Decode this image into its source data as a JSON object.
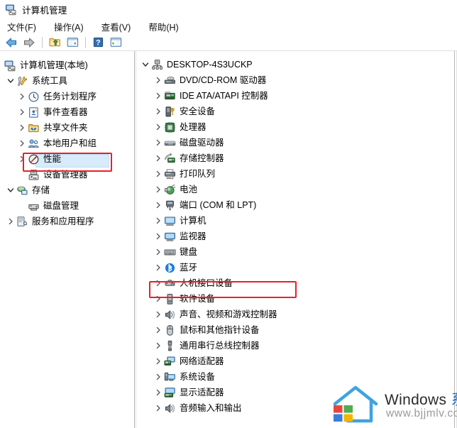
{
  "window": {
    "title": "计算机管理",
    "title_icon": "computer-management-icon"
  },
  "menubar": {
    "items": [
      {
        "label": "文件(F)",
        "name": "menu-file"
      },
      {
        "label": "操作(A)",
        "name": "menu-action"
      },
      {
        "label": "查看(V)",
        "name": "menu-view"
      },
      {
        "label": "帮助(H)",
        "name": "menu-help"
      }
    ]
  },
  "toolbar": {
    "buttons": [
      {
        "name": "back-button",
        "icon": "arrow-left-icon",
        "title": "后退"
      },
      {
        "name": "forward-button",
        "icon": "arrow-right-icon",
        "title": "前进"
      },
      {
        "name": "up-folder-button",
        "icon": "folder-up-icon",
        "title": "向上一级"
      },
      {
        "name": "show-hide-tree-button",
        "icon": "show-tree-icon",
        "title": "显示/隐藏控制台树"
      },
      {
        "name": "help-button",
        "icon": "question-mark-icon",
        "title": "帮助"
      },
      {
        "name": "show-action-pane-button",
        "icon": "action-pane-icon",
        "title": "显示/隐藏操作窗格"
      }
    ]
  },
  "left_tree": {
    "root": {
      "label": "计算机管理(本地)",
      "icon": "computer-management-icon",
      "expanded": true
    },
    "items": [
      {
        "label": "系统工具",
        "icon": "system-tools-icon",
        "indent": 1,
        "chevron": "expanded"
      },
      {
        "label": "任务计划程序",
        "icon": "task-scheduler-icon",
        "indent": 2,
        "chevron": "collapsed"
      },
      {
        "label": "事件查看器",
        "icon": "event-viewer-icon",
        "indent": 2,
        "chevron": "collapsed"
      },
      {
        "label": "共享文件夹",
        "icon": "shared-folders-icon",
        "indent": 2,
        "chevron": "collapsed"
      },
      {
        "label": "本地用户和组",
        "icon": "local-users-groups-icon",
        "indent": 2,
        "chevron": "collapsed"
      },
      {
        "label": "性能",
        "icon": "performance-icon",
        "indent": 2,
        "chevron": "collapsed"
      },
      {
        "label": "设备管理器",
        "icon": "device-manager-icon",
        "indent": 2,
        "chevron": "none",
        "selected": true,
        "highlighted": true
      },
      {
        "label": "存储",
        "icon": "storage-icon",
        "indent": 1,
        "chevron": "expanded"
      },
      {
        "label": "磁盘管理",
        "icon": "disk-management-icon",
        "indent": 2,
        "chevron": "none"
      },
      {
        "label": "服务和应用程序",
        "icon": "services-apps-icon",
        "indent": 1,
        "chevron": "collapsed"
      }
    ]
  },
  "right_tree": {
    "root": {
      "label": "DESKTOP-4S3UCKP",
      "icon": "computer-node-icon",
      "chevron": "expanded"
    },
    "items": [
      {
        "label": "DVD/CD-ROM 驱动器",
        "icon": "dvd-drive-icon",
        "chevron": "collapsed"
      },
      {
        "label": "IDE ATA/ATAPI 控制器",
        "icon": "ide-controller-icon",
        "chevron": "collapsed"
      },
      {
        "label": "安全设备",
        "icon": "security-device-icon",
        "chevron": "collapsed"
      },
      {
        "label": "处理器",
        "icon": "processor-icon",
        "chevron": "collapsed"
      },
      {
        "label": "磁盘驱动器",
        "icon": "disk-drive-icon",
        "chevron": "collapsed"
      },
      {
        "label": "存储控制器",
        "icon": "storage-controller-icon",
        "chevron": "collapsed"
      },
      {
        "label": "打印队列",
        "icon": "print-queue-icon",
        "chevron": "collapsed"
      },
      {
        "label": "电池",
        "icon": "battery-icon",
        "chevron": "collapsed"
      },
      {
        "label": "端口 (COM 和 LPT)",
        "icon": "ports-icon",
        "chevron": "collapsed"
      },
      {
        "label": "计算机",
        "icon": "computer-icon",
        "chevron": "collapsed"
      },
      {
        "label": "监视器",
        "icon": "monitor-icon",
        "chevron": "collapsed"
      },
      {
        "label": "键盘",
        "icon": "keyboard-icon",
        "chevron": "collapsed"
      },
      {
        "label": "蓝牙",
        "icon": "bluetooth-icon",
        "chevron": "collapsed"
      },
      {
        "label": "人机接口设备",
        "icon": "hid-device-icon",
        "chevron": "collapsed"
      },
      {
        "label": "软件设备",
        "icon": "software-device-icon",
        "chevron": "collapsed"
      },
      {
        "label": "声音、视频和游戏控制器",
        "icon": "sound-video-game-icon",
        "chevron": "collapsed",
        "highlighted": true
      },
      {
        "label": "鼠标和其他指针设备",
        "icon": "mouse-icon",
        "chevron": "collapsed"
      },
      {
        "label": "通用串行总线控制器",
        "icon": "usb-controller-icon",
        "chevron": "collapsed"
      },
      {
        "label": "网络适配器",
        "icon": "network-adapter-icon",
        "chevron": "collapsed"
      },
      {
        "label": "系统设备",
        "icon": "system-device-icon",
        "chevron": "collapsed"
      },
      {
        "label": "显示适配器",
        "icon": "display-adapter-icon",
        "chevron": "collapsed"
      },
      {
        "label": "音频输入和输出",
        "icon": "audio-io-icon",
        "chevron": "collapsed"
      }
    ]
  },
  "annotations": {
    "highlight_color": "#e8202a",
    "boxes": [
      {
        "name": "device-manager-highlight-box",
        "target": "设备管理器"
      },
      {
        "name": "sound-video-game-controller-highlight-box",
        "target": "声音、视频和游戏控制器"
      }
    ]
  },
  "watermark": {
    "brand_en": "Windows ",
    "brand_cn": "系统之家",
    "url": "www.bjjmlv.com",
    "logo": "house-windows-logo"
  }
}
